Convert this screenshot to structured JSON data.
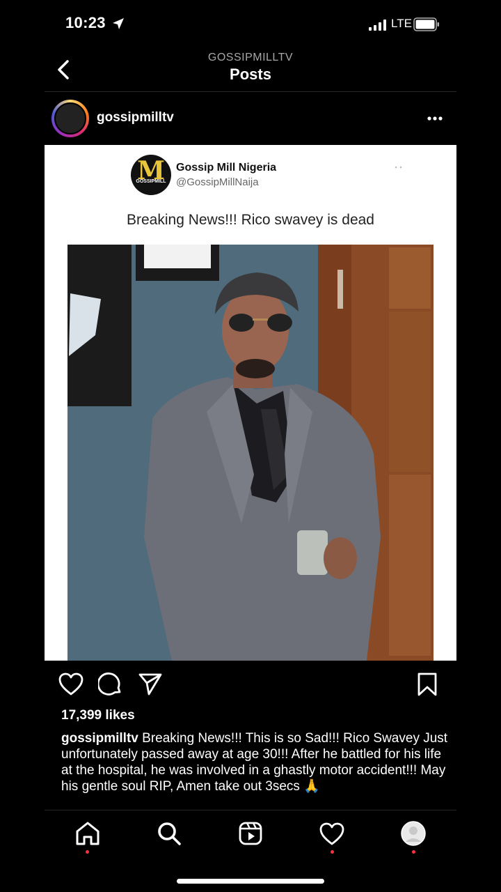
{
  "status_bar": {
    "time": "10:23",
    "network": "LTE",
    "location_icon": "location-arrow-icon",
    "signal_icon": "cellular-signal-icon",
    "battery_icon": "battery-icon"
  },
  "header": {
    "account": "GOSSIPMILLTV",
    "title": "Posts",
    "back_icon": "chevron-left-icon"
  },
  "post": {
    "username": "gossipmilltv",
    "more_icon": "more-horizontal-icon",
    "tweet": {
      "logo_letter": "M",
      "logo_text": "GOSSIPMILL",
      "display_name": "Gossip Mill Nigeria",
      "handle": "@GossipMillNaija",
      "text": "Breaking News!!! Rico swavey is dead"
    },
    "actions": {
      "like": "heart-icon",
      "comment": "comment-icon",
      "share": "send-icon",
      "save": "bookmark-icon"
    },
    "likes": "17,399 likes",
    "caption_user": "gossipmilltv",
    "caption_text": "Breaking News!!! This is so Sad!!! Rico Swavey Just unfortunately passed away at age 30!!! After he battled for his life at the hospital, he was involved in a ghastly motor accident!!! May his gentle soul RIP, Amen take out 3secs 🙏"
  },
  "bottom_nav": {
    "items": [
      {
        "name": "home",
        "icon": "home-icon",
        "badge": true
      },
      {
        "name": "search",
        "icon": "search-icon",
        "badge": false
      },
      {
        "name": "reels",
        "icon": "reels-icon",
        "badge": false
      },
      {
        "name": "activity",
        "icon": "heart-icon",
        "badge": true
      },
      {
        "name": "profile",
        "icon": "profile-avatar-icon",
        "badge": true
      }
    ]
  },
  "colors": {
    "background": "#000000",
    "notification": "#ff3040",
    "card": "#ffffff"
  }
}
